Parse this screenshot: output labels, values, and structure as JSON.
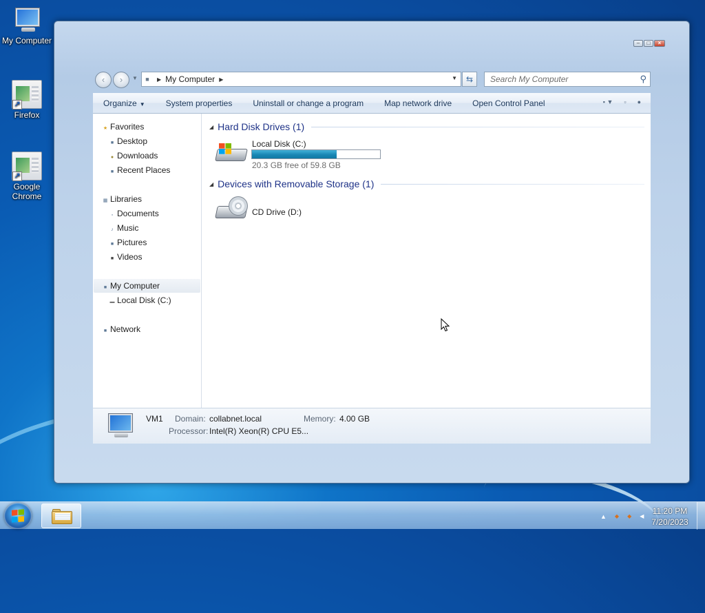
{
  "desktop": {
    "icons": [
      {
        "label": "My Computer"
      },
      {
        "label": "Firefox"
      },
      {
        "label": "Google Chrome"
      }
    ]
  },
  "window": {
    "address": {
      "location": "My Computer"
    },
    "search": {
      "placeholder": "Search My Computer"
    },
    "toolbar": {
      "organize": "Organize",
      "system_properties": "System properties",
      "uninstall": "Uninstall or change a program",
      "map_drive": "Map network drive",
      "control_panel": "Open Control Panel"
    },
    "nav_pane": {
      "favorites": "Favorites",
      "desktop": "Desktop",
      "downloads": "Downloads",
      "recent_places": "Recent Places",
      "libraries": "Libraries",
      "documents": "Documents",
      "music": "Music",
      "pictures": "Pictures",
      "videos": "Videos",
      "my_computer": "My Computer",
      "local_disk": "Local Disk (C:)",
      "network": "Network"
    },
    "groups": {
      "hard_disks": "Hard Disk Drives (1)",
      "removable": "Devices with Removable Storage (1)"
    },
    "drives": {
      "local_disk": {
        "name": "Local Disk (C:)",
        "free_text": "20.3 GB free of 59.8 GB",
        "used_fraction": 0.66
      },
      "cd_drive": {
        "name": "CD Drive (D:)"
      }
    },
    "details": {
      "computer_name": "VM1",
      "domain_label": "Domain:",
      "domain_value": "collabnet.local",
      "memory_label": "Memory:",
      "memory_value": "4.00 GB",
      "processor_label": "Processor:",
      "processor_value": "Intel(R) Xeon(R) CPU E5..."
    }
  },
  "taskbar": {
    "time": "11:20 PM",
    "date": "7/20/2023"
  }
}
